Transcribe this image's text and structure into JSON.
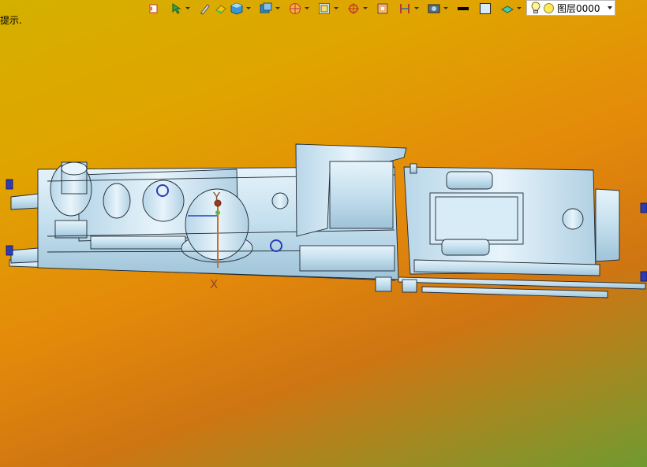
{
  "toolbar": {
    "buttons": [
      {
        "icon": "undo-view-icon",
        "has_dropdown": false
      },
      {
        "icon": "select-filter-icon",
        "has_dropdown": true
      },
      {
        "icon": "pen-icon",
        "has_dropdown": false
      },
      {
        "icon": "eraser-icon",
        "has_dropdown": false
      },
      {
        "icon": "shaded-cube-icon",
        "has_dropdown": true
      },
      {
        "icon": "view-cube-icon",
        "has_dropdown": true
      },
      {
        "icon": "render-sphere-icon",
        "has_dropdown": true
      },
      {
        "icon": "frame-icon",
        "has_dropdown": true
      },
      {
        "icon": "orient-target-icon",
        "has_dropdown": true
      },
      {
        "icon": "snap-box-icon",
        "has_dropdown": false
      },
      {
        "icon": "section-plane-icon",
        "has_dropdown": true
      },
      {
        "icon": "display-filter-icon",
        "has_dropdown": true
      },
      {
        "icon": "line-color-icon",
        "has_dropdown": false
      },
      {
        "icon": "fill-color-icon",
        "has_dropdown": false
      },
      {
        "icon": "material-icon",
        "has_dropdown": true
      }
    ],
    "layer_selector": {
      "label": "图层0000",
      "bulb_icon": "lightbulb-icon",
      "state_icon": "layer-on-dot-icon"
    }
  },
  "hint_text": "提示.",
  "triad": {
    "y_label": "Y",
    "x_label": "X"
  },
  "colors": {
    "model_fill": "#cfe6f3",
    "model_edge": "#1f2a33",
    "accent_blue": "#2b3cb8"
  }
}
